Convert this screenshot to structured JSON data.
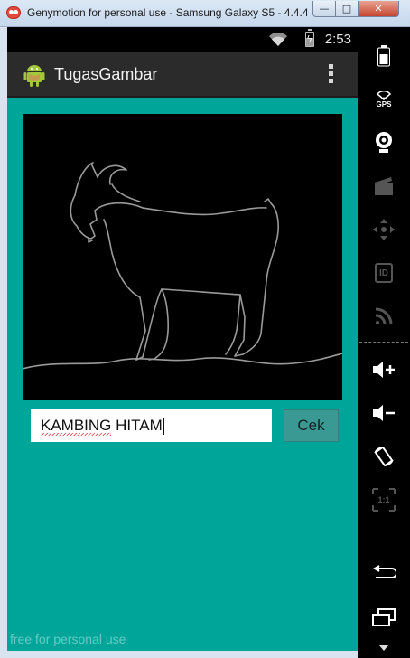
{
  "window": {
    "title": "Genymotion for personal use - Samsung Galaxy S5 - 4.4.4...",
    "minimize_glyph": "—",
    "maximize_glyph": "□",
    "close_glyph": "✕"
  },
  "status_bar": {
    "time": "2:53",
    "icons": [
      "wifi-icon",
      "battery-charging-icon"
    ]
  },
  "action_bar": {
    "app_name": "TugasGambar",
    "icons": [
      "android-icon",
      "overflow-menu-icon"
    ]
  },
  "main": {
    "image_description_icon": "goat-outline-drawing",
    "answer_input": {
      "value": "KAMBING HITAM",
      "misspelled_word": "KAMBING"
    },
    "check_button_label": "Cek"
  },
  "watermark": "free for personal use",
  "sidebar": {
    "items": [
      {
        "icon": "battery-icon"
      },
      {
        "icon": "gps-icon",
        "label": "GPS"
      },
      {
        "icon": "webcam-icon"
      },
      {
        "icon": "capture-icon"
      },
      {
        "icon": "dpad-icon"
      },
      {
        "icon": "device-id-icon",
        "label": "ID"
      },
      {
        "icon": "cast-icon"
      },
      {
        "icon": "volume-up-icon"
      },
      {
        "icon": "volume-down-icon"
      },
      {
        "icon": "rotate-icon"
      },
      {
        "icon": "scale-icon",
        "label": "1:1"
      },
      {
        "icon": "back-icon"
      },
      {
        "icon": "recent-apps-icon"
      },
      {
        "icon": "scroll-down-icon"
      }
    ]
  },
  "colors": {
    "app_background": "#00a59a",
    "action_bar": "#2b2b2b",
    "button": "#3a9a93",
    "status_bar": "#000000"
  }
}
